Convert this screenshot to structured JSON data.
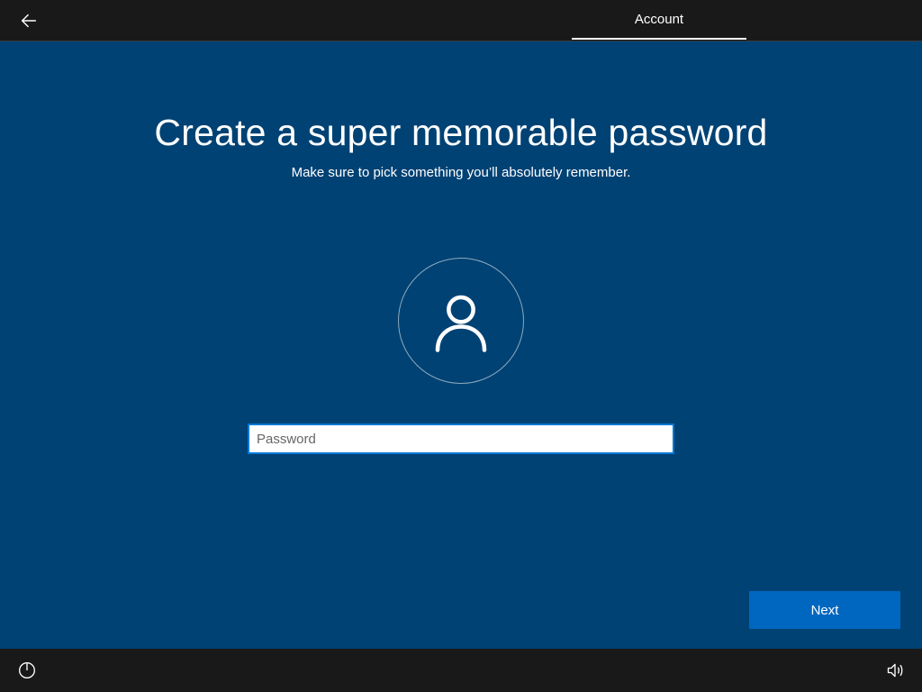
{
  "header": {
    "step_label": "Account"
  },
  "page": {
    "title": "Create a super memorable password",
    "subtitle": "Make sure to pick something you’ll absolutely remember.",
    "password_placeholder": "Password",
    "password_value": "",
    "next_label": "Next"
  },
  "icons": {
    "back": "back-arrow-icon",
    "avatar": "user-icon",
    "ease_of_access": "ease-of-access-icon",
    "volume": "volume-icon"
  },
  "colors": {
    "background": "#004274",
    "accent": "#0067c0",
    "input_border": "#0078d7",
    "topbar": "#191919"
  }
}
